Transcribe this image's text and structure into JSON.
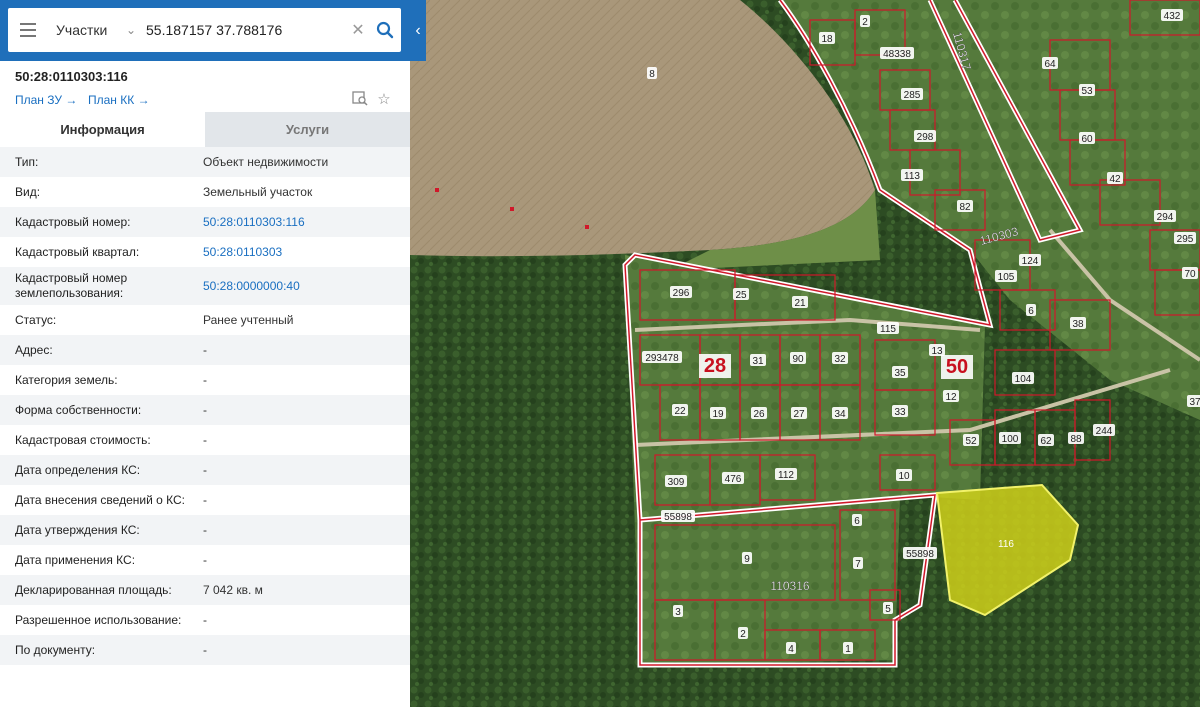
{
  "search": {
    "layer": "Участки",
    "query": "55.187157 37.788176"
  },
  "parcel": {
    "title": "50:28:0110303:116",
    "plan_zu": "План ЗУ",
    "plan_kk": "План КК"
  },
  "tabs": [
    {
      "label": "Информация",
      "active": true
    },
    {
      "label": "Услуги",
      "active": false
    }
  ],
  "info_rows": [
    {
      "label": "Тип:",
      "value": "Объект недвижимости",
      "link": false
    },
    {
      "label": "Вид:",
      "value": "Земельный участок",
      "link": false
    },
    {
      "label": "Кадастровый номер:",
      "value": "50:28:0110303:116",
      "link": true
    },
    {
      "label": "Кадастровый квартал:",
      "value": "50:28:0110303",
      "link": true
    },
    {
      "label": "Кадастровый номер землепользования:",
      "value": "50:28:0000000:40",
      "link": true
    },
    {
      "label": "Статус:",
      "value": "Ранее учтенный",
      "link": false
    },
    {
      "label": "Адрес:",
      "value": "-",
      "link": false
    },
    {
      "label": "Категория земель:",
      "value": "-",
      "link": false
    },
    {
      "label": "Форма собственности:",
      "value": "-",
      "link": false
    },
    {
      "label": "Кадастровая стоимость:",
      "value": "-",
      "link": false
    },
    {
      "label": "Дата определения КС:",
      "value": "-",
      "link": false
    },
    {
      "label": "Дата внесения сведений о КС:",
      "value": "-",
      "link": false
    },
    {
      "label": "Дата утверждения КС:",
      "value": "-",
      "link": false
    },
    {
      "label": "Дата применения КС:",
      "value": "-",
      "link": false
    },
    {
      "label": "Декларированная площадь:",
      "value": "7 042 кв. м",
      "link": false
    },
    {
      "label": "Разрешенное использование:",
      "value": "-",
      "link": false
    },
    {
      "label": "По документу:",
      "value": "-",
      "link": false
    }
  ],
  "map": {
    "selected_parcel": "116",
    "quarter_labels": [
      "110317",
      "110303",
      "110316"
    ],
    "big_labels": [
      "28",
      "50"
    ],
    "plot_labels": [
      "8",
      "2",
      "18",
      "48338",
      "64",
      "53",
      "60",
      "42",
      "432",
      "285",
      "298",
      "113",
      "82",
      "105",
      "124",
      "6",
      "38",
      "294",
      "295",
      "70",
      "296",
      "25",
      "21",
      "115",
      "13",
      "35",
      "12",
      "33",
      "104",
      "52",
      "100",
      "62",
      "88",
      "244",
      "293478",
      "31",
      "90",
      "32",
      "22",
      "19",
      "26",
      "27",
      "34",
      "309",
      "476",
      "112",
      "10",
      "55898",
      "6",
      "9",
      "7",
      "5",
      "3",
      "2",
      "4",
      "1",
      "55898",
      "37"
    ],
    "colors": {
      "boundary": "#d0182a",
      "selected_fill": "#cfd01a",
      "forest": "#2e4d24",
      "field": "#a89572"
    }
  }
}
